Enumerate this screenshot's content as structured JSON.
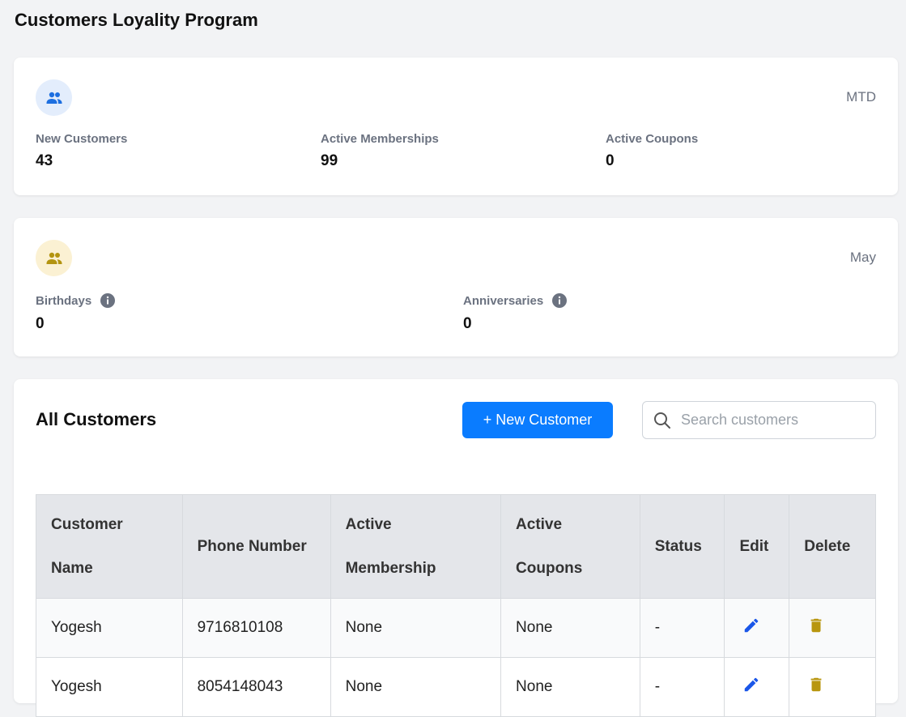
{
  "page": {
    "title": "Customers Loyality Program"
  },
  "summary": {
    "period": "MTD",
    "stats": [
      {
        "label": "New Customers",
        "value": "43"
      },
      {
        "label": "Active Memberships",
        "value": "99"
      },
      {
        "label": "Active Coupons",
        "value": "0"
      }
    ]
  },
  "events": {
    "period": "May",
    "stats": [
      {
        "label": "Birthdays",
        "value": "0"
      },
      {
        "label": "Anniversaries",
        "value": "0"
      }
    ]
  },
  "customers_section": {
    "title": "All Customers",
    "new_button_label": "+ New Customer",
    "search_placeholder": "Search customers",
    "columns": [
      "Customer Name",
      "Phone Number",
      "Active Membership",
      "Active Coupons",
      "Status",
      "Edit",
      "Delete"
    ],
    "rows": [
      {
        "name": "Yogesh",
        "phone": "9716810108",
        "membership": "None",
        "coupons": "None",
        "status": "-"
      },
      {
        "name": "Yogesh",
        "phone": "8054148043",
        "membership": "None",
        "coupons": "None",
        "status": "-"
      }
    ]
  },
  "colors": {
    "accent": "#0a7cff",
    "summary_icon_bg": "#e3edfc",
    "summary_icon": "#1d6fe0",
    "events_icon_bg": "#fbf1d3",
    "events_icon": "#b39410",
    "edit_icon": "#1a56e8",
    "delete_icon": "#b8960e"
  },
  "icons": {
    "summary": "people-icon",
    "events": "people-icon",
    "info": "info-icon",
    "search": "search-icon",
    "edit": "pencil-icon",
    "delete": "trash-icon"
  }
}
